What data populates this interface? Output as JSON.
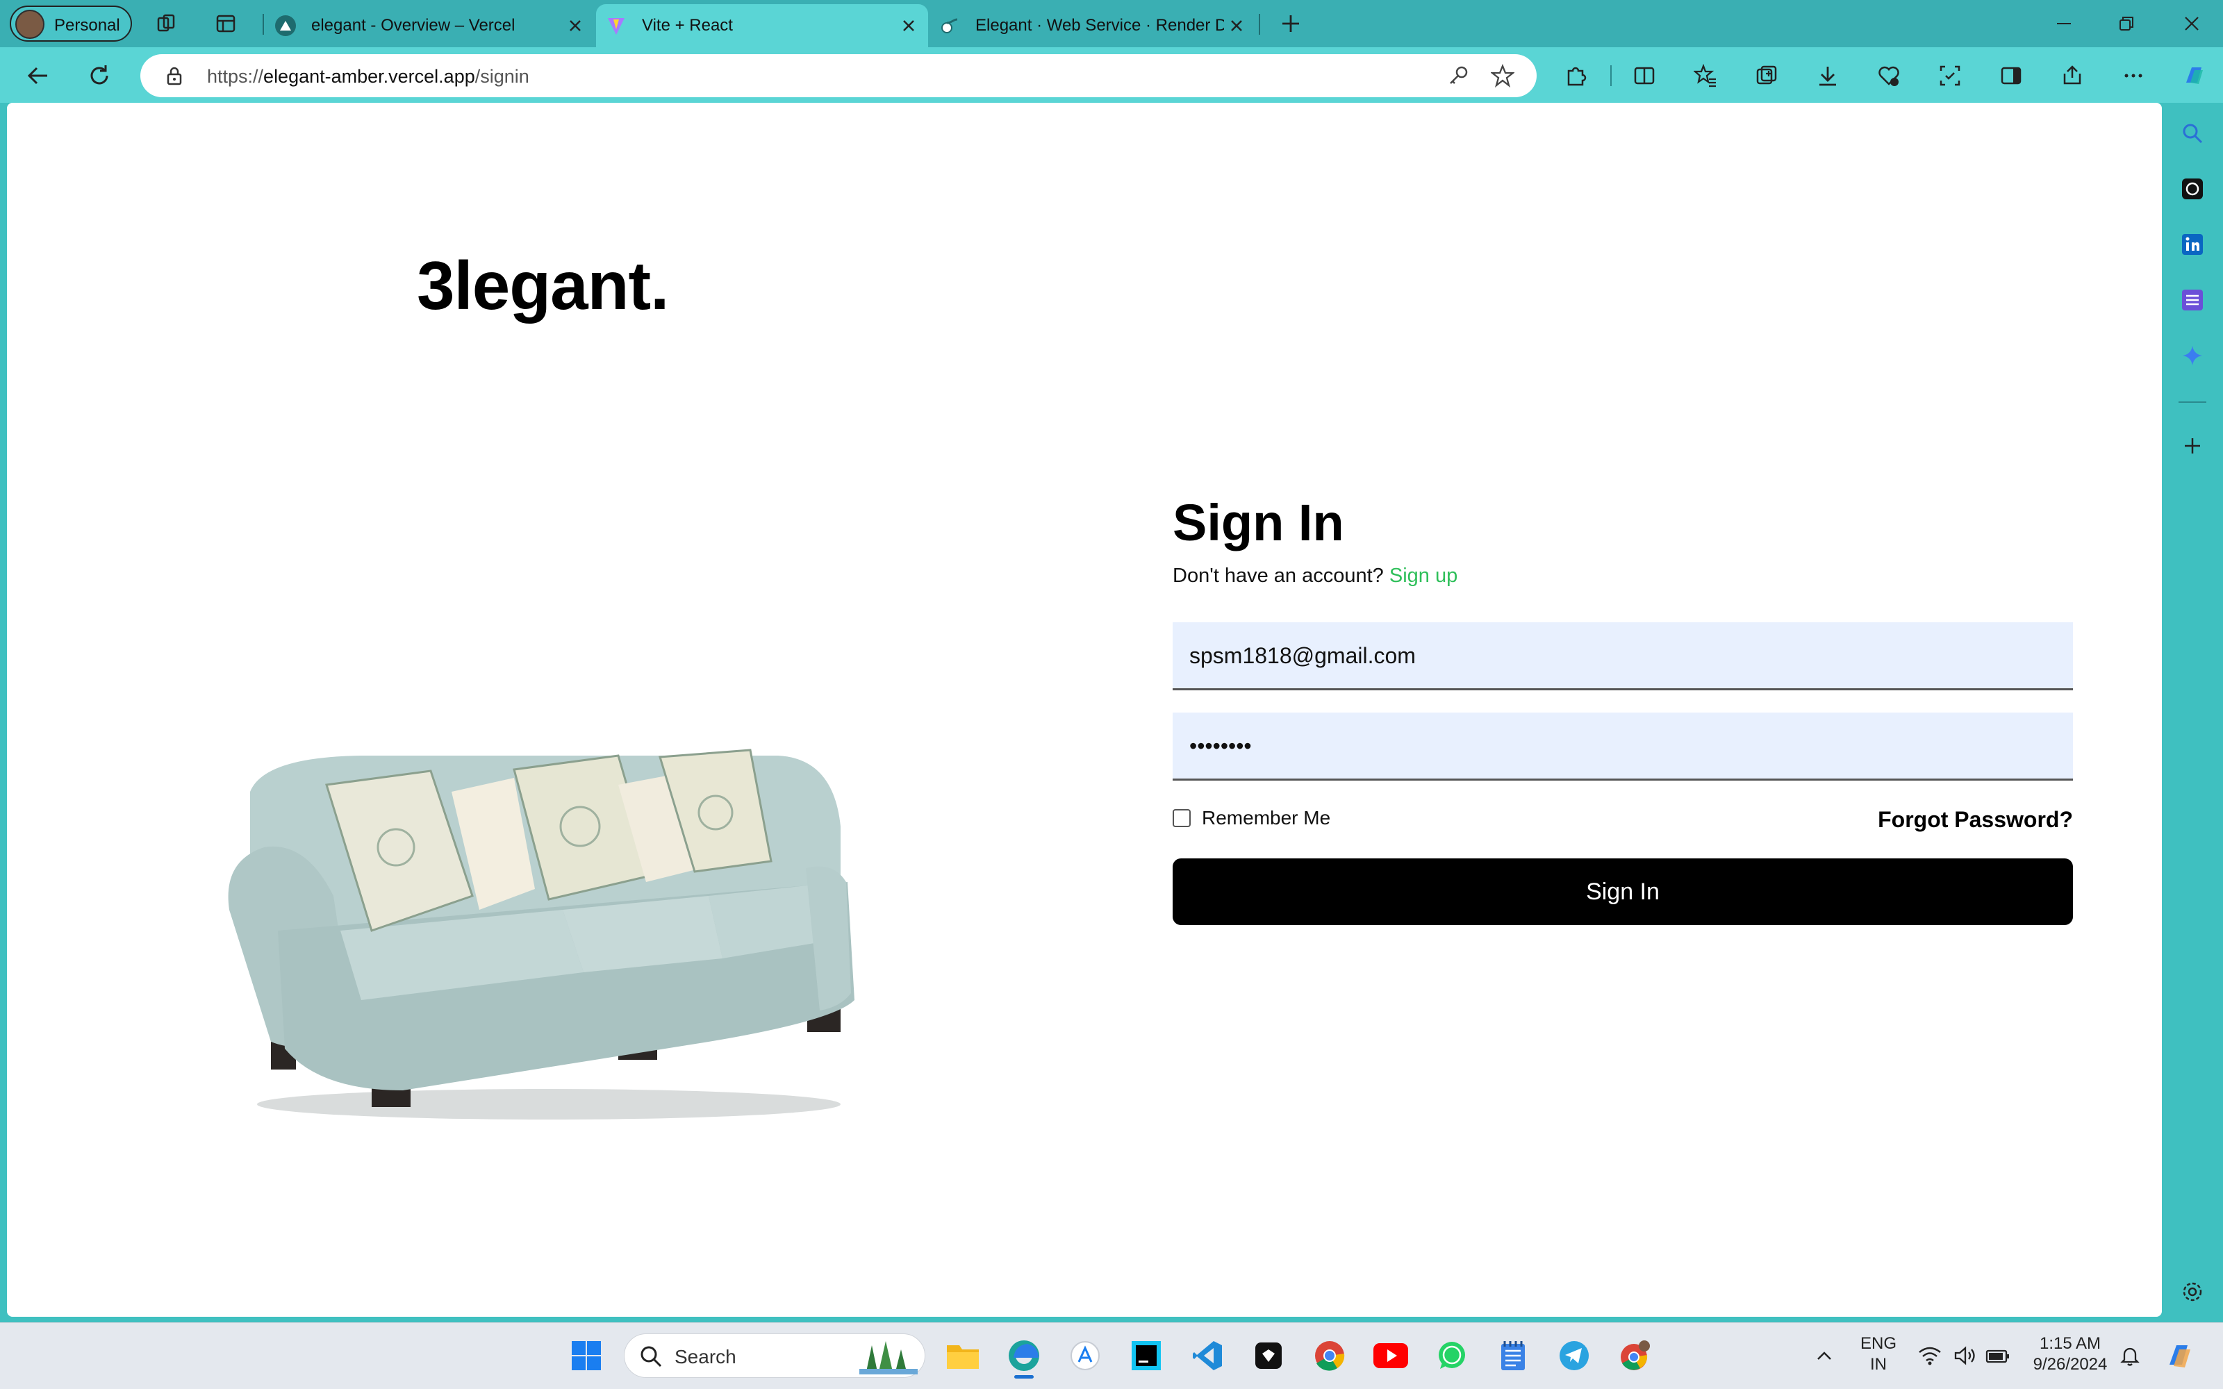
{
  "browser": {
    "profile_label": "Personal",
    "tabs": [
      {
        "title": "elegant - Overview – Vercel",
        "active": false
      },
      {
        "title": "Vite + React",
        "active": true
      },
      {
        "title": "Elegant · Web Service · Render Dashboard",
        "active": false
      }
    ],
    "url_prefix": "https://",
    "url_host": "elegant-amber.vercel.app",
    "url_path": "/signin"
  },
  "page": {
    "logo": "3legant.",
    "heading": "Sign In",
    "no_account_text": "Don't have an account?",
    "signup_link": "Sign up",
    "email_value": "spsm1818@gmail.com",
    "password_value": "••••••••",
    "remember_label": "Remember Me",
    "forgot_label": "Forgot Password?",
    "submit_label": "Sign In",
    "product_image": "sofa-image"
  },
  "taskbar": {
    "search_label": "Search",
    "lang_line1": "ENG",
    "lang_line2": "IN",
    "time": "1:15 AM",
    "date": "9/26/2024"
  },
  "colors": {
    "browser_accent": "#3fc0c0",
    "signup_link": "#2fbf5a",
    "button_bg": "#000000",
    "field_bg": "#e8f0fe"
  }
}
